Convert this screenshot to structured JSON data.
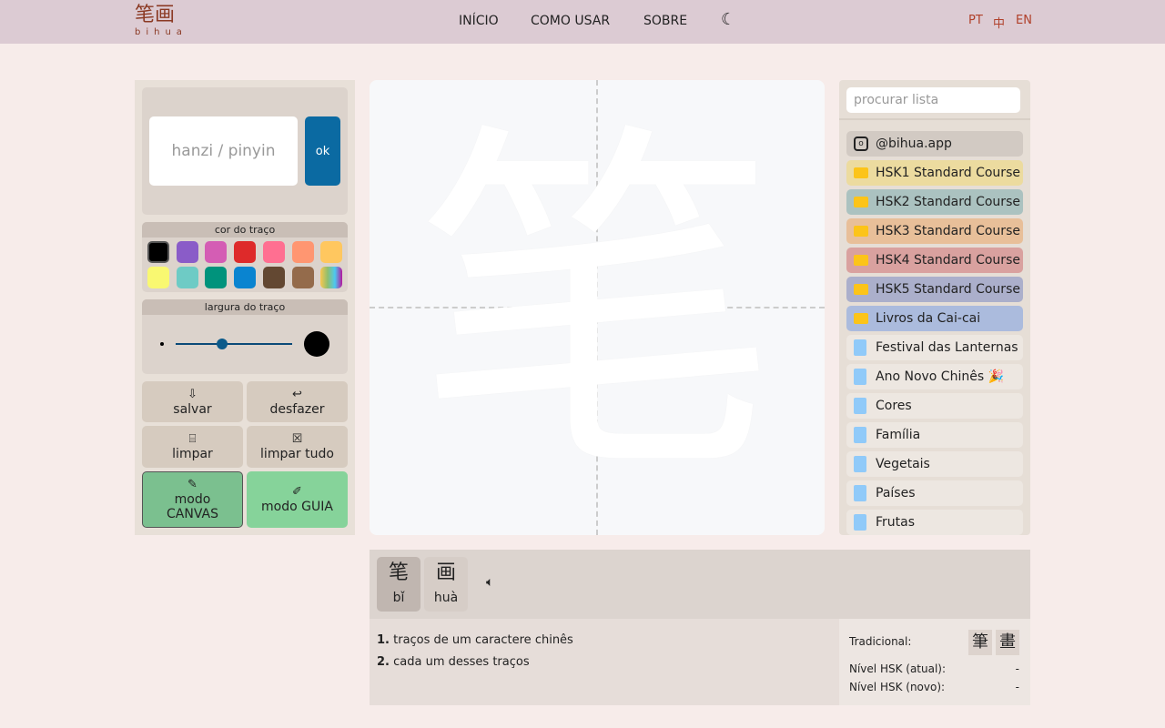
{
  "header": {
    "logo_zh": "笔画",
    "logo_py": "bihua",
    "nav": [
      "INÍCIO",
      "COMO USAR",
      "SOBRE"
    ],
    "theme_icon": "moon-icon",
    "langs": [
      "PT",
      "中",
      "EN"
    ]
  },
  "left": {
    "input_placeholder": "hanzi / pinyin",
    "ok": "ok",
    "color_title": "cor do traço",
    "colors": [
      "#000000",
      "#8a5cc8",
      "#d45db4",
      "#de2a2a",
      "#ff6f91",
      "#ff9671",
      "#ffc75f",
      "#f9f871",
      "#6ecbc5",
      "#00937c",
      "#0a84d0",
      "#634832",
      "#946b4b",
      "rainbow"
    ],
    "width_title": "largura do traço",
    "stroke_width": 0.4,
    "buttons": {
      "save": "salvar",
      "undo": "desfazer",
      "clear": "limpar",
      "clear_all": "limpar tudo",
      "canvas_mode": "modo CANVAS",
      "guide_mode": "modo GUIA"
    }
  },
  "canvas": {
    "character": "笔"
  },
  "right": {
    "search_placeholder": "procurar lista",
    "instagram": "@bihua.app",
    "folders": [
      {
        "label": "HSK1 Standard Course",
        "color": "#ecdb9f"
      },
      {
        "label": "HSK2 Standard Course",
        "color": "#abc2c0"
      },
      {
        "label": "HSK3 Standard Course",
        "color": "#e8bf99"
      },
      {
        "label": "HSK4 Standard Course",
        "color": "#d9a19f"
      },
      {
        "label": "HSK5 Standard Course",
        "color": "#abafcb"
      },
      {
        "label": "Livros da Cai-cai",
        "color": "#abbbdd"
      }
    ],
    "lists": [
      "Festival das Lanternas",
      "Ano Novo Chinês 🎉",
      "Cores",
      "Família",
      "Vegetais",
      "Países",
      "Frutas"
    ]
  },
  "word": {
    "chars": [
      {
        "c": "笔",
        "p": "bǐ"
      },
      {
        "c": "画",
        "p": "huà"
      }
    ],
    "definitions": [
      "traços de um caractere chinês",
      "cada um desses traços"
    ],
    "traditional_label": "Tradicional:",
    "traditional": [
      "筆",
      "畫"
    ],
    "hsk_current_label": "Nível HSK (atual):",
    "hsk_current": "-",
    "hsk_new_label": "Nível HSK (novo):",
    "hsk_new": "-"
  }
}
